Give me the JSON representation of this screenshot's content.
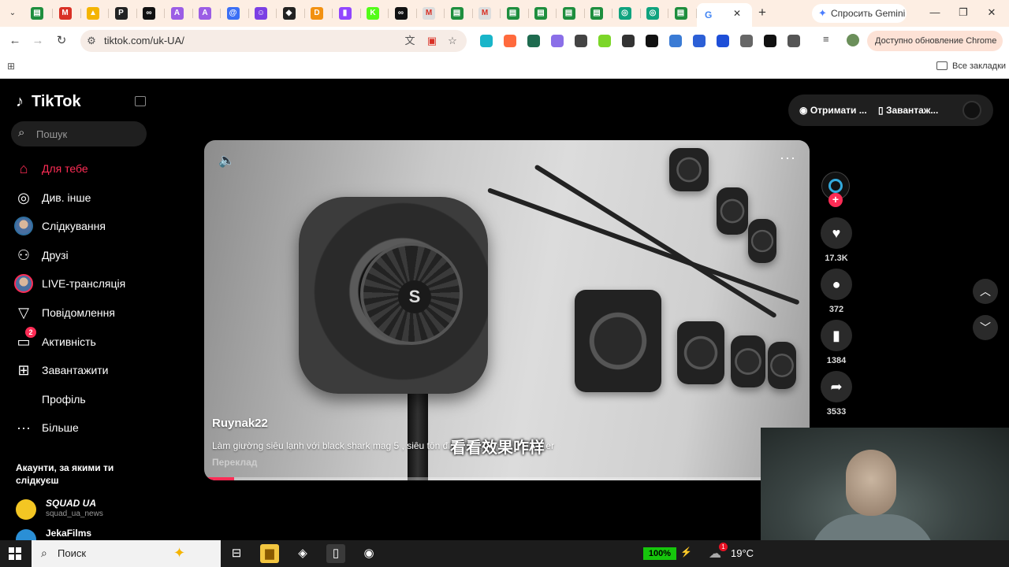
{
  "browser": {
    "tab_close": "✕",
    "new_tab": "+",
    "gemini_label": "Спросить Gemini",
    "url": "tiktok.com/uk-UA/",
    "update_label": "Доступно обновление Chrome",
    "all_bookmarks": "Все закладки",
    "tab_favicons": [
      {
        "icon": "sheets-icon",
        "color": "#1e8e3e",
        "glyph": "▤"
      },
      {
        "icon": "gmail-icon",
        "color": "#d93025",
        "glyph": "M"
      },
      {
        "icon": "drive-icon",
        "color": "#f4b400",
        "glyph": "▲"
      },
      {
        "icon": "p-icon",
        "color": "#222222",
        "glyph": "P"
      },
      {
        "icon": "infinity-icon",
        "color": "#111111",
        "glyph": "∞"
      },
      {
        "icon": "ai-icon",
        "color": "#9b5de5",
        "glyph": "A"
      },
      {
        "icon": "ai-icon",
        "color": "#9b5de5",
        "glyph": "A"
      },
      {
        "icon": "at-icon",
        "color": "#3b6ff5",
        "glyph": "@"
      },
      {
        "icon": "bot-icon",
        "color": "#7b3fe4",
        "glyph": "☺"
      },
      {
        "icon": "diamond-icon",
        "color": "#222222",
        "glyph": "◆"
      },
      {
        "icon": "d-icon",
        "color": "#f29111",
        "glyph": "D"
      },
      {
        "icon": "twitch-icon",
        "color": "#9146ff",
        "glyph": "▮"
      },
      {
        "icon": "k-icon",
        "color": "#53fc18",
        "glyph": "K"
      },
      {
        "icon": "infinity-icon",
        "color": "#111111",
        "glyph": "∞"
      },
      {
        "icon": "mail-icon",
        "color": "#dddddd",
        "glyph": "M"
      },
      {
        "icon": "sheets-icon",
        "color": "#1e8e3e",
        "glyph": "▤"
      },
      {
        "icon": "mail-icon",
        "color": "#dddddd",
        "glyph": "M"
      },
      {
        "icon": "sheets-icon",
        "color": "#1e8e3e",
        "glyph": "▤"
      },
      {
        "icon": "sheets-icon",
        "color": "#1e8e3e",
        "glyph": "▤"
      },
      {
        "icon": "sheets-icon",
        "color": "#1e8e3e",
        "glyph": "▤"
      },
      {
        "icon": "sheets-icon",
        "color": "#1e8e3e",
        "glyph": "▤"
      },
      {
        "icon": "chatgpt-icon",
        "color": "#10a37f",
        "glyph": "◎"
      },
      {
        "icon": "chatgpt-icon",
        "color": "#10a37f",
        "glyph": "◎"
      },
      {
        "icon": "sheets-icon",
        "color": "#1e8e3e",
        "glyph": "▤"
      },
      {
        "icon": "google-icon",
        "color": "#ffffff",
        "glyph": "G"
      }
    ],
    "extensions": [
      {
        "icon": "ext-teal-icon",
        "color": "#19b5c9"
      },
      {
        "icon": "ext-n-icon",
        "color": "#ff6a3d"
      },
      {
        "icon": "ext-hash-icon",
        "color": "#1e6b4f"
      },
      {
        "icon": "ext-cloud-icon",
        "color": "#8a6fe8"
      },
      {
        "icon": "ext-chart-icon",
        "color": "#444444"
      },
      {
        "icon": "ext-green-icon",
        "color": "#7cd629"
      },
      {
        "icon": "ext-c-icon",
        "color": "#333333"
      },
      {
        "icon": "ext-qr-icon",
        "color": "#111111"
      },
      {
        "icon": "ext-s-icon",
        "color": "#3a7bd5"
      },
      {
        "icon": "ext-plane-icon",
        "color": "#2c5fd6"
      },
      {
        "icon": "ext-shield-icon",
        "color": "#1e4fd8"
      },
      {
        "icon": "ext-blob-icon",
        "color": "#666666"
      },
      {
        "icon": "ext-a-icon",
        "color": "#111111"
      },
      {
        "icon": "extensions-icon",
        "color": "#555555"
      }
    ]
  },
  "sidebar": {
    "logo": "TikTok",
    "search_placeholder": "Пошук",
    "items": [
      {
        "label": "Для тебе",
        "icon": "home-icon",
        "glyph": "⌂",
        "active": true
      },
      {
        "label": "Див. інше",
        "icon": "compass-icon",
        "glyph": "◎"
      },
      {
        "label": "Слідкування",
        "icon": "following-avatar-icon",
        "glyph": ""
      },
      {
        "label": "Друзі",
        "icon": "friends-icon",
        "glyph": "⚇"
      },
      {
        "label": "LIVE-трансляція",
        "icon": "live-avatar-icon",
        "glyph": ""
      },
      {
        "label": "Повідомлення",
        "icon": "messages-icon",
        "glyph": "▽"
      },
      {
        "label": "Активність",
        "icon": "activity-icon",
        "glyph": "▭",
        "badge": "2"
      },
      {
        "label": "Завантажити",
        "icon": "upload-icon",
        "glyph": "⊞"
      },
      {
        "label": "Профіль",
        "icon": "profile-icon",
        "glyph": ""
      },
      {
        "label": "Більше",
        "icon": "more-icon",
        "glyph": "···"
      }
    ],
    "following_title": "Акаунти, за якими ти слідкуєш",
    "accounts": [
      {
        "name": "SQUAD UA",
        "handle": "squad_ua_news",
        "color": "#f3c623"
      },
      {
        "name": "JekaFilms",
        "handle": "",
        "color": "#2a8fd6"
      }
    ]
  },
  "top_actions": {
    "get_coins": "Отримати ...",
    "download": "Завантаж..."
  },
  "video": {
    "author": "Ruynak22",
    "caption": "Làm giường siêu lạnh với black shark mag 5 , siêu tôn điện#sofanh #phonecooler",
    "subtitle": "看看效果咋样",
    "translate": "Переклад",
    "progress": 0.05
  },
  "actions": {
    "likes": "17.3K",
    "comments": "372",
    "saves": "1384",
    "shares": "3533"
  },
  "taskbar": {
    "search_label": "Поиск",
    "battery": "100%",
    "temperature": "19°C",
    "weather_badge": "1",
    "apps": [
      {
        "icon": "task-view-icon",
        "glyph": "⊟",
        "color": "transparent"
      },
      {
        "icon": "file-explorer-icon",
        "glyph": "▆",
        "color": "#f3c640"
      },
      {
        "icon": "notes-app-icon",
        "glyph": "◈",
        "color": "transparent"
      },
      {
        "icon": "file-app-icon",
        "glyph": "▯",
        "color": "#3a3a3a"
      },
      {
        "icon": "recorder-app-icon",
        "glyph": "◉",
        "color": "transparent"
      }
    ]
  }
}
